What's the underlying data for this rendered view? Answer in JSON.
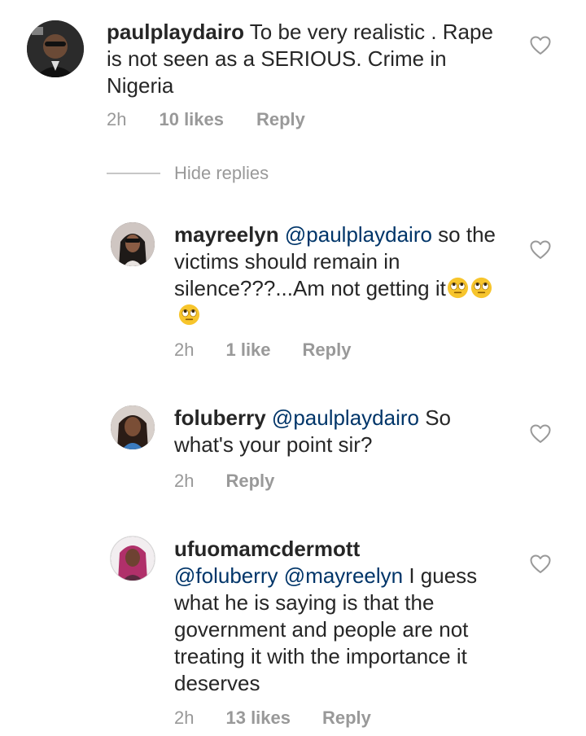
{
  "comments": [
    {
      "username": "paulplaydairo",
      "text": " To be very realistic . Rape is not seen as a SERIOUS. Crime in Nigeria",
      "time": "2h",
      "likes": "10 likes",
      "reply": "Reply"
    },
    {
      "username": "mayreelyn",
      "mention": "@paulplaydairo",
      "text": " so the victims should remain in silence???...Am not getting it",
      "emoji": "face-with-rolling-eyes",
      "time": "2h",
      "likes": "1 like",
      "reply": "Reply"
    },
    {
      "username": "foluberry",
      "mention": "@paulplaydairo",
      "text": " So what's your point sir?",
      "time": "2h",
      "reply": "Reply"
    },
    {
      "username": "ufuomamcdermott",
      "mention1": "@foluberry",
      "mention2": "@mayreelyn",
      "text": " I guess what he is saying is that the government and people  are not treating it with the importance it deserves",
      "time": "2h",
      "likes": "13 likes",
      "reply": "Reply"
    }
  ],
  "hide_replies": "Hide replies",
  "colors": {
    "text": "#262626",
    "meta": "#999999",
    "mention": "#003569",
    "divider": "#c7c7c7"
  },
  "icons": {
    "like": "heart-outline-icon",
    "emoji": "face-with-rolling-eyes"
  }
}
